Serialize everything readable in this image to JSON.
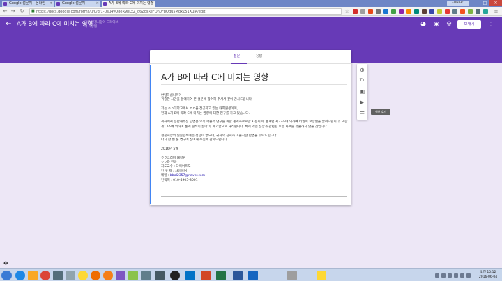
{
  "browser": {
    "tabs": [
      {
        "label": "Google 설문지 - 온라인"
      },
      {
        "label": "Google 설문지"
      },
      {
        "label": "A가 B에 따라 C에 미치는 영향"
      }
    ],
    "profile": "EUN HO",
    "window_controls": {
      "minimize": "–",
      "maximize": "□",
      "close": "✕"
    },
    "url": "https://docs.google.com/forms/u/0/d/1-Dsu4vQ8eR9hLxZ_g6ZdsReFQn0FbOdu5MqxZ51XuiA/edit",
    "star_icon": "star-icon"
  },
  "forms_header": {
    "back_icon": "arrow-back-icon",
    "title": "A가 B에 따라 C에 미치는 영향",
    "save_note": "모든 변경사항이 드라이브에 저장됨",
    "send_label": "보내기",
    "accent_color": "#673ab7"
  },
  "editor": {
    "tabs": [
      {
        "label": "질문",
        "active": true
      },
      {
        "label": "응답",
        "active": false
      }
    ],
    "form_title": "A가 B에 따라 C에 미치는 영향",
    "description": {
      "greeting": "안녕하십니까?\n귀중한 시간을 할애하여 본 설문에 참여해 주셔서 깊이 감사드립니다.",
      "intro": "저는 ㅇㅇ대학교에서 ㅇㅇ을 전공하고 있는 대학원생이며,\n현재 A가 B에 따라 C에 미치는 영향에 대한 연구를 하고 있습니다.",
      "privacy": "귀하께서 응답해주신 답변은 오직 학술적 연구를 위한 통계자료로만 사용되며, 통계법 제33조에 의하여 비밀이 보장됨을 알려드립니다. 또한 제13조에 의하여 통계 분석이 끝나 후 폐기함으로 처리됩니다. 특히 개인 신상과 관련된 모든 자료를 유출하지 않을 것입니다.",
      "request": "설문지상의 질문항목에는 정답이 없으며, 귀하의 진지하고 솔직한 답변을 부탁드립니다.\n다시 한 번 본 연구에 참여해 주심에 감사드립니다.",
      "date": "2016년 5월",
      "signature_lines": [
        "ㅇㅇ크리미 대학원",
        "ㅇㅇ과 전공",
        "지도교수 : 다이어트도",
        "연 구 자 : 사유이여"
      ],
      "email_label": "메일 : ",
      "email": "bbol2357@naver.com",
      "contact": "연락처 : 010-4905-8001"
    }
  },
  "side_toolbar": {
    "items": [
      {
        "icon": "add-circle-icon",
        "glyph": "⊕"
      },
      {
        "icon": "title-text-icon",
        "glyph": "Tт"
      },
      {
        "icon": "image-icon",
        "glyph": "▣"
      },
      {
        "icon": "video-icon",
        "glyph": "▶"
      },
      {
        "icon": "section-icon",
        "glyph": "☰"
      }
    ],
    "tooltip": "섹션 추가"
  },
  "taskbar": {
    "apps": [
      "ie-icon",
      "folder-icon",
      "chrome-icon",
      "media-icon",
      "paint-icon",
      "kakao-icon",
      "app-icon",
      "app-icon",
      "camera-icon",
      "outlook-icon",
      "powerpoint-icon",
      "excel-icon",
      "word-icon",
      "hangul-icon",
      "notes-icon",
      "kakaotalk-icon"
    ],
    "clock_time": "오전 10:12",
    "clock_date": "2016-06-04"
  }
}
